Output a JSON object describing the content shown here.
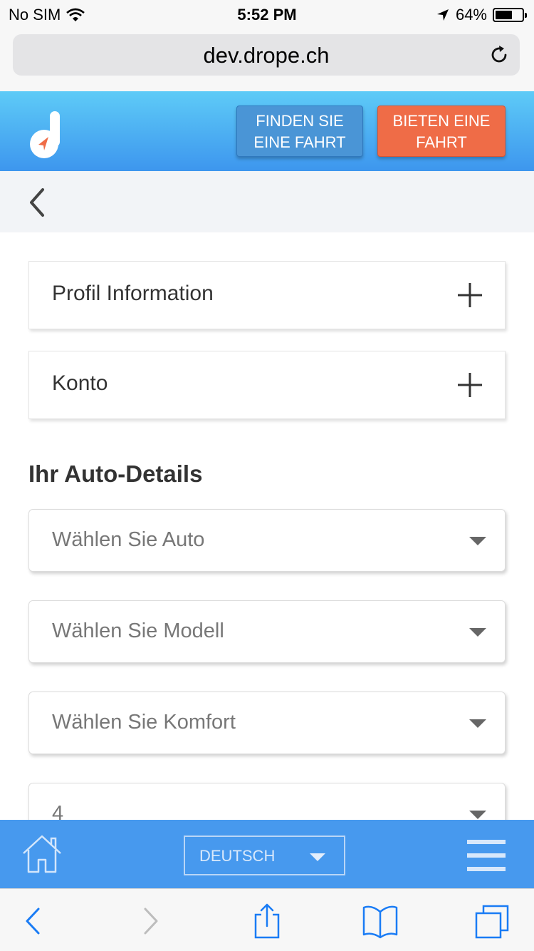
{
  "status_bar": {
    "carrier": "No SIM",
    "time": "5:52 PM",
    "battery": "64%",
    "battery_level": 0.64
  },
  "browser": {
    "url": "dev.drope.ch"
  },
  "header": {
    "find_button": "FINDEN SIE EINE FAHRT",
    "offer_button": "BIETEN EINE FAHRT",
    "find_color": "#4a95d6",
    "offer_color": "#ef6c47"
  },
  "panels": [
    {
      "label": "Profil Information"
    },
    {
      "label": "Konto"
    }
  ],
  "car_details": {
    "title": "Ihr Auto-Details",
    "selects": [
      {
        "placeholder": "Wählen Sie Auto"
      },
      {
        "placeholder": "Wählen Sie Modell"
      },
      {
        "placeholder": "Wählen Sie Komfort"
      },
      {
        "placeholder": "4"
      }
    ]
  },
  "footer": {
    "language": "DEUTSCH"
  },
  "icons": {
    "wifi": "wifi-icon",
    "location": "location-arrow-icon",
    "reload": "reload-icon",
    "back": "chevron-left-icon",
    "expand": "plus-icon",
    "dropdown": "caret-down-icon",
    "home": "home-icon",
    "menu": "hamburger-menu-icon",
    "share": "share-icon",
    "bookmarks": "bookmarks-icon",
    "tabs": "tabs-icon"
  }
}
